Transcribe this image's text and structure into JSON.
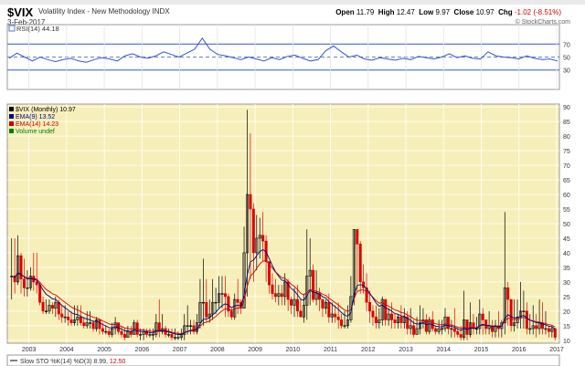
{
  "header": {
    "symbol": "$VIX",
    "description": "Volatility Index - New Methodology  INDX",
    "date": "3-Feb-2017",
    "open_label": "Open",
    "open_value": "11.79",
    "high_label": "High",
    "high_value": "12.47",
    "low_label": "Low",
    "low_value": "9.97",
    "close_label": "Close",
    "close_value": "10.97",
    "chg_label": "Chg",
    "chg_value": "-1.02 (-8.51%)",
    "brand": "© StockCharts.com"
  },
  "rsi_panel": {
    "label": "RSI(14) 44.18",
    "ticks": [
      "70",
      "50",
      "30"
    ]
  },
  "price_panel": {
    "legend": [
      {
        "text": "$VIX (Monthly) 10.97",
        "color": "#000000"
      },
      {
        "text": "EMA(9) 13.52",
        "color": "#000080"
      },
      {
        "text": "EMA(14) 14.23",
        "color": "#cc0000"
      },
      {
        "text": "Volume undef",
        "color": "#008000"
      }
    ],
    "y_ticks": [
      "90",
      "85",
      "80",
      "75",
      "70",
      "65",
      "60",
      "55",
      "50",
      "45",
      "40",
      "35",
      "30",
      "25",
      "20",
      "15",
      "10"
    ],
    "x_ticks": [
      "2003",
      "2004",
      "2005",
      "2006",
      "2007",
      "2008",
      "2009",
      "2010",
      "2011",
      "2012",
      "2013",
      "2014",
      "2015",
      "2016",
      "2017"
    ]
  },
  "sto_panel": {
    "label_prefix": "Slow STO %K(14) %D(3) ",
    "k_value": "8.99",
    "d_value": "12.50"
  },
  "colors": {
    "price_bg": "#f7efb9",
    "rsi_bg": "#ffffff",
    "up_candle": "#000000",
    "down_candle": "#dd0000",
    "ema9": "#000080",
    "ema14": "#cc0000",
    "rsi_line": "#3355cc"
  },
  "chart_data": [
    {
      "type": "line",
      "title": "RSI(14) 44.18",
      "ylim": [
        0,
        100
      ],
      "ticks": [
        30,
        50,
        70
      ],
      "x_start": "2002-07",
      "x_end": "2017-02",
      "values": [
        48,
        56,
        50,
        44,
        50,
        46,
        43,
        46,
        48,
        44,
        42,
        46,
        49,
        47,
        44,
        52,
        55,
        50,
        48,
        52,
        58,
        54,
        50,
        56,
        62,
        79,
        62,
        54,
        52,
        49,
        46,
        50,
        47,
        44,
        49,
        46,
        51,
        53,
        48,
        44,
        46,
        60,
        67,
        58,
        50,
        53,
        47,
        45,
        49,
        47,
        45,
        48,
        46,
        51,
        49,
        47,
        50,
        55,
        49,
        52,
        48,
        47,
        58,
        52,
        50,
        49,
        47,
        52,
        48,
        46,
        47,
        44
      ]
    },
    {
      "type": "candlestick",
      "title": "$VIX (Monthly) 10.97",
      "ylim": [
        9,
        91
      ],
      "x_start": "2002-07",
      "x_end": "2017-02",
      "months": [
        "2002-07",
        "2002-08",
        "2002-09",
        "2002-10",
        "2002-11",
        "2002-12",
        "2003-01",
        "2003-02",
        "2003-03",
        "2003-04",
        "2003-05",
        "2003-06",
        "2003-07",
        "2003-08",
        "2003-09",
        "2003-10",
        "2003-11",
        "2003-12",
        "2004-01",
        "2004-02",
        "2004-03",
        "2004-04",
        "2004-05",
        "2004-06",
        "2004-07",
        "2004-08",
        "2004-09",
        "2004-10",
        "2004-11",
        "2004-12",
        "2005-01",
        "2005-02",
        "2005-03",
        "2005-04",
        "2005-05",
        "2005-06",
        "2005-07",
        "2005-08",
        "2005-09",
        "2005-10",
        "2005-11",
        "2005-12",
        "2006-01",
        "2006-02",
        "2006-03",
        "2006-04",
        "2006-05",
        "2006-06",
        "2006-07",
        "2006-08",
        "2006-09",
        "2006-10",
        "2006-11",
        "2006-12",
        "2007-01",
        "2007-02",
        "2007-03",
        "2007-04",
        "2007-05",
        "2007-06",
        "2007-07",
        "2007-08",
        "2007-09",
        "2007-10",
        "2007-11",
        "2007-12",
        "2008-01",
        "2008-02",
        "2008-03",
        "2008-04",
        "2008-05",
        "2008-06",
        "2008-07",
        "2008-08",
        "2008-09",
        "2008-10",
        "2008-11",
        "2008-12",
        "2009-01",
        "2009-02",
        "2009-03",
        "2009-04",
        "2009-05",
        "2009-06",
        "2009-07",
        "2009-08",
        "2009-09",
        "2009-10",
        "2009-11",
        "2009-12",
        "2010-01",
        "2010-02",
        "2010-03",
        "2010-04",
        "2010-05",
        "2010-06",
        "2010-07",
        "2010-08",
        "2010-09",
        "2010-10",
        "2010-11",
        "2010-12",
        "2011-01",
        "2011-02",
        "2011-03",
        "2011-04",
        "2011-05",
        "2011-06",
        "2011-07",
        "2011-08",
        "2011-09",
        "2011-10",
        "2011-11",
        "2011-12",
        "2012-01",
        "2012-02",
        "2012-03",
        "2012-04",
        "2012-05",
        "2012-06",
        "2012-07",
        "2012-08",
        "2012-09",
        "2012-10",
        "2012-11",
        "2012-12",
        "2013-01",
        "2013-02",
        "2013-03",
        "2013-04",
        "2013-05",
        "2013-06",
        "2013-07",
        "2013-08",
        "2013-09",
        "2013-10",
        "2013-11",
        "2013-12",
        "2014-01",
        "2014-02",
        "2014-03",
        "2014-04",
        "2014-05",
        "2014-06",
        "2014-07",
        "2014-08",
        "2014-09",
        "2014-10",
        "2014-11",
        "2014-12",
        "2015-01",
        "2015-02",
        "2015-03",
        "2015-04",
        "2015-05",
        "2015-06",
        "2015-07",
        "2015-08",
        "2015-09",
        "2015-10",
        "2015-11",
        "2015-12",
        "2016-01",
        "2016-02",
        "2016-03",
        "2016-04",
        "2016-05",
        "2016-06",
        "2016-07",
        "2016-08",
        "2016-09",
        "2016-10",
        "2016-11",
        "2016-12",
        "2017-01",
        "2017-02"
      ],
      "close": [
        32,
        30,
        39,
        31,
        28,
        28,
        32,
        30,
        29,
        23,
        20,
        20,
        22,
        21,
        23,
        19,
        18,
        18,
        17,
        16,
        17,
        18,
        16,
        15,
        16,
        16,
        14,
        17,
        14,
        13,
        13,
        12,
        14,
        16,
        13,
        12,
        11,
        13,
        12,
        16,
        12,
        12,
        13,
        12,
        12,
        12,
        16,
        13,
        14,
        12,
        12,
        11,
        11,
        11,
        12,
        15,
        15,
        15,
        13,
        16,
        23,
        23,
        18,
        19,
        23,
        23,
        26,
        26,
        25,
        20,
        18,
        24,
        23,
        21,
        40,
        60,
        55,
        40,
        45,
        46,
        44,
        37,
        29,
        26,
        25,
        26,
        25,
        30,
        24,
        22,
        24,
        20,
        18,
        22,
        32,
        34,
        24,
        26,
        24,
        21,
        23,
        18,
        19,
        18,
        17,
        15,
        15,
        17,
        25,
        48,
        43,
        30,
        28,
        23,
        20,
        18,
        16,
        17,
        24,
        17,
        19,
        17,
        16,
        18,
        16,
        18,
        14,
        15,
        12,
        14,
        16,
        17,
        13,
        17,
        14,
        13,
        14,
        14,
        18,
        14,
        14,
        13,
        12,
        11,
        17,
        12,
        16,
        14,
        14,
        19,
        17,
        14,
        15,
        13,
        15,
        14,
        16,
        28,
        24,
        15,
        16,
        18,
        20,
        20,
        14,
        14,
        15,
        14,
        16,
        14,
        14,
        13,
        14,
        11
      ],
      "high": [
        45,
        45,
        46,
        40,
        38,
        34,
        35,
        40,
        40,
        30,
        25,
        24,
        24,
        23,
        25,
        24,
        22,
        22,
        20,
        20,
        22,
        22,
        22,
        18,
        20,
        20,
        17,
        18,
        17,
        16,
        15,
        14,
        16,
        18,
        16,
        15,
        14,
        15,
        15,
        17,
        17,
        14,
        14,
        14,
        14,
        14,
        19,
        24,
        19,
        15,
        14,
        14,
        14,
        13,
        14,
        19,
        22,
        17,
        17,
        19,
        31,
        38,
        31,
        24,
        31,
        28,
        32,
        32,
        32,
        26,
        21,
        26,
        31,
        24,
        49,
        89,
        81,
        57,
        53,
        52,
        54,
        46,
        36,
        33,
        31,
        29,
        29,
        33,
        31,
        25,
        28,
        29,
        24,
        26,
        48,
        45,
        36,
        34,
        28,
        24,
        24,
        26,
        23,
        22,
        23,
        19,
        20,
        22,
        32,
        48,
        47,
        44,
        36,
        33,
        27,
        22,
        22,
        21,
        25,
        22,
        21,
        23,
        19,
        19,
        22,
        21,
        20,
        21,
        17,
        18,
        22,
        21,
        19,
        18,
        20,
        15,
        17,
        17,
        21,
        18,
        17,
        21,
        14,
        15,
        27,
        17,
        23,
        19,
        18,
        24,
        21,
        17,
        20,
        17,
        17,
        20,
        17,
        54,
        30,
        24,
        24,
        24,
        30,
        27,
        23,
        19,
        22,
        19,
        24,
        23,
        20,
        15,
        15,
        13
      ],
      "low": [
        24,
        26,
        29,
        26,
        25,
        25,
        27,
        27,
        26,
        22,
        19,
        19,
        19,
        19,
        18,
        17,
        16,
        16,
        15,
        15,
        15,
        15,
        15,
        14,
        14,
        14,
        13,
        13,
        12,
        12,
        12,
        11,
        11,
        12,
        12,
        11,
        10,
        11,
        11,
        12,
        11,
        10,
        10,
        11,
        11,
        10,
        11,
        11,
        12,
        11,
        11,
        10,
        10,
        10,
        10,
        10,
        12,
        12,
        12,
        12,
        14,
        15,
        16,
        16,
        17,
        19,
        21,
        21,
        18,
        18,
        17,
        17,
        19,
        19,
        21,
        25,
        31,
        30,
        34,
        38,
        37,
        30,
        26,
        24,
        23,
        22,
        22,
        22,
        20,
        19,
        18,
        18,
        18,
        16,
        17,
        22,
        23,
        22,
        20,
        18,
        19,
        16,
        16,
        16,
        14,
        14,
        14,
        14,
        16,
        22,
        27,
        26,
        26,
        20,
        16,
        15,
        14,
        14,
        15,
        15,
        15,
        14,
        14,
        14,
        14,
        14,
        12,
        12,
        11,
        12,
        12,
        14,
        12,
        12,
        13,
        12,
        12,
        12,
        13,
        12,
        11,
        11,
        11,
        10,
        10,
        10,
        11,
        12,
        12,
        12,
        12,
        12,
        12,
        11,
        11,
        11,
        11,
        12,
        15,
        13,
        13,
        14,
        14,
        14,
        12,
        12,
        12,
        11,
        12,
        12,
        12,
        11,
        11,
        10
      ]
    },
    {
      "type": "line",
      "title": "EMA(9) 13.52",
      "ema_period": 9,
      "derived_from": "close"
    },
    {
      "type": "line",
      "title": "EMA(14) 14.23",
      "ema_period": 14,
      "derived_from": "close"
    },
    {
      "type": "line",
      "title": "Slow STO %K(14) %D(3) 8.99, 12.50",
      "series": [
        {
          "name": "%K(14)",
          "last": 8.99
        },
        {
          "name": "%D(3)",
          "last": 12.5
        }
      ]
    }
  ]
}
